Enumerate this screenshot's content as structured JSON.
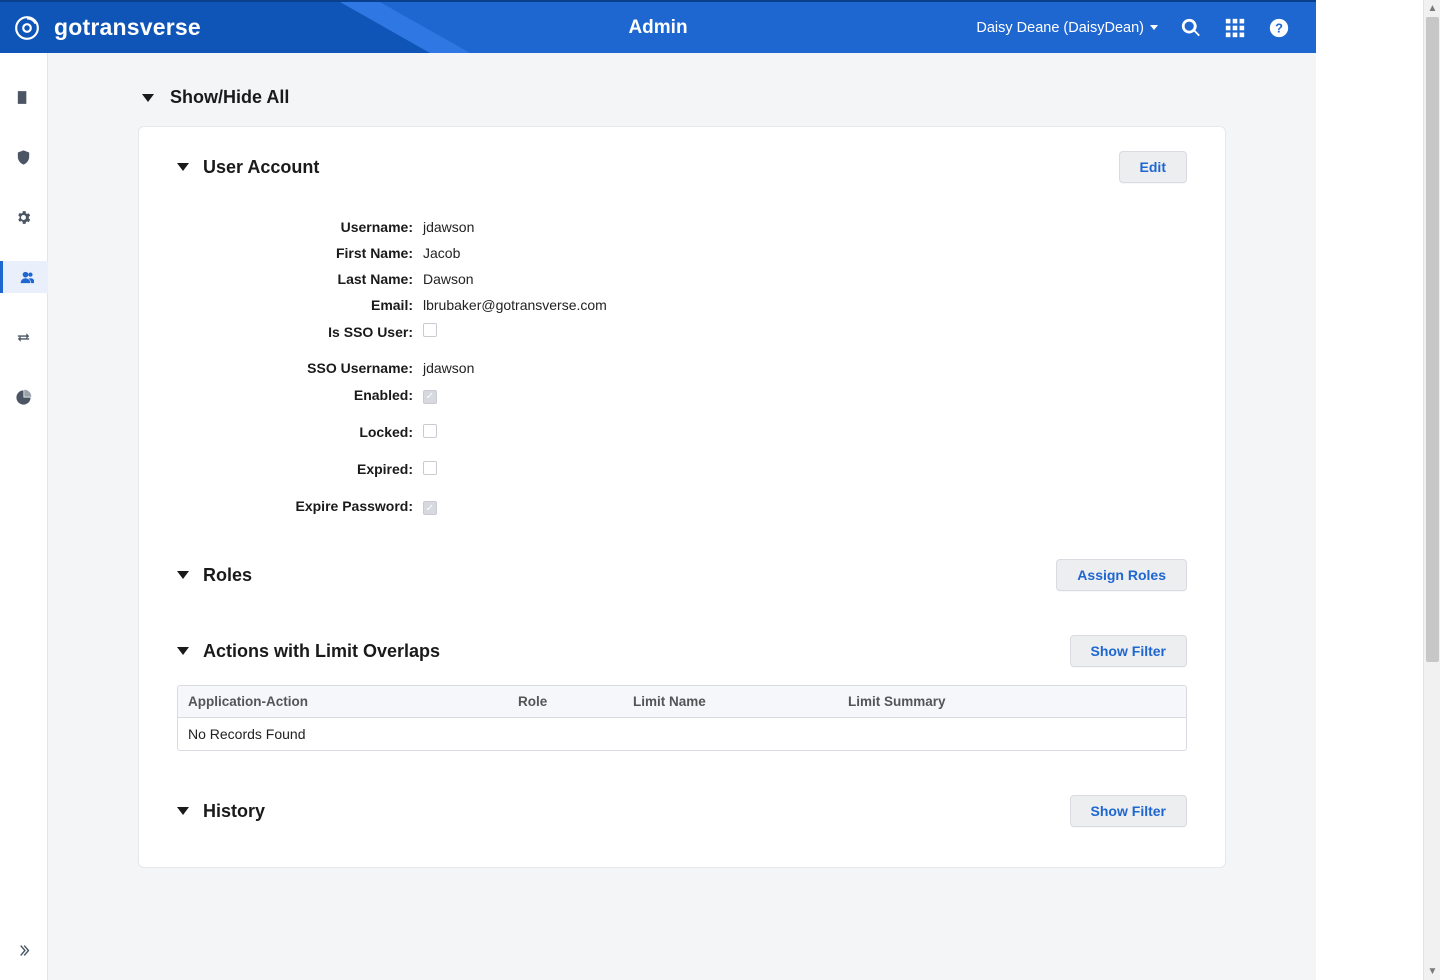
{
  "header": {
    "brand": "gotransverse",
    "page_title": "Admin",
    "user_label": "Daisy Deane (DaisyDean)"
  },
  "toggle_all": "Show/Hide All",
  "sections": {
    "user_account": {
      "title": "User Account",
      "edit_btn": "Edit",
      "fields": {
        "username_label": "Username:",
        "username_value": "jdawson",
        "firstname_label": "First Name:",
        "firstname_value": "Jacob",
        "lastname_label": "Last Name:",
        "lastname_value": "Dawson",
        "email_label": "Email:",
        "email_value": "lbrubaker@gotransverse.com",
        "is_sso_label": "Is SSO User:",
        "sso_username_label": "SSO Username:",
        "sso_username_value": "jdawson",
        "enabled_label": "Enabled:",
        "locked_label": "Locked:",
        "expired_label": "Expired:",
        "expire_pw_label": "Expire Password:"
      }
    },
    "roles": {
      "title": "Roles",
      "assign_btn": "Assign Roles"
    },
    "overlaps": {
      "title": "Actions with Limit Overlaps",
      "filter_btn": "Show Filter",
      "cols": {
        "a": "Application-Action",
        "b": "Role",
        "c": "Limit Name",
        "d": "Limit Summary"
      },
      "empty": "No Records Found"
    },
    "history": {
      "title": "History",
      "filter_btn": "Show Filter"
    }
  }
}
